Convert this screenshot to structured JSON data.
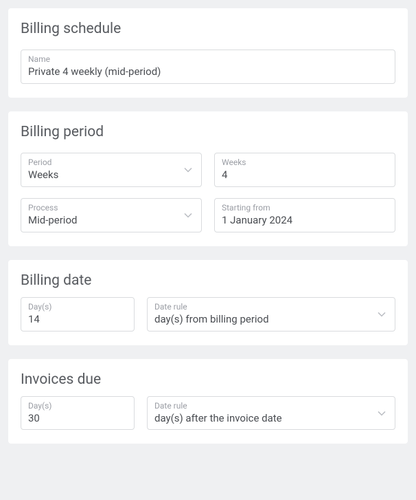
{
  "billing_schedule": {
    "title": "Billing schedule",
    "name_label": "Name",
    "name_value": "Private 4 weekly (mid-period)"
  },
  "billing_period": {
    "title": "Billing period",
    "period_label": "Period",
    "period_value": "Weeks",
    "weeks_label": "Weeks",
    "weeks_value": "4",
    "process_label": "Process",
    "process_value": "Mid-period",
    "starting_label": "Starting from",
    "starting_value": "1 January 2024"
  },
  "billing_date": {
    "title": "Billing date",
    "days_label": "Day(s)",
    "days_value": "14",
    "rule_label": "Date rule",
    "rule_value": "day(s) from billing period"
  },
  "invoices_due": {
    "title": "Invoices due",
    "days_label": "Day(s)",
    "days_value": "30",
    "rule_label": "Date rule",
    "rule_value": "day(s) after the invoice date"
  }
}
